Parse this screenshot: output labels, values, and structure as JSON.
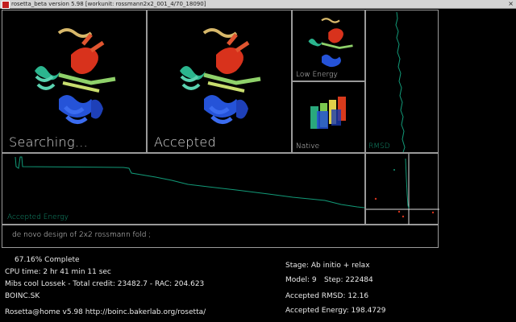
{
  "window": {
    "title": "rosetta_beta version 5.98 [workunit: rossmann2x2_001_4/70_18090]",
    "close_glyph": "×"
  },
  "panels": {
    "searching_label": "Searching...",
    "accepted_label": "Accepted",
    "low_energy_label": "Low Energy",
    "native_label": "Native",
    "rmsd_label": "RMSD",
    "accepted_energy_label": "Accepted Energy"
  },
  "description": "de novo design of 2x2 rossmann fold ;",
  "stats": {
    "complete": "67.16% Complete",
    "cpu_time": "CPU time: 2 hr 41 min 11 sec",
    "user_line": "Mibs cool Lossek - Total credit: 23482.7 - RAC: 204.623",
    "team": "BOINC.SK",
    "version_line": "Rosetta@home v5.98 http://boinc.bakerlab.org/rosetta/"
  },
  "progress": {
    "stage": "Stage: Ab initio + relax",
    "model": "Model: 9",
    "step": "Step: 222484",
    "accepted_rmsd": "Accepted RMSD: 12.16",
    "accepted_energy": "Accepted Energy: 198.4729"
  },
  "colors": {
    "panel_border": "#9a9a9a",
    "energy_trace": "#129a78",
    "marker_red": "#d4331c",
    "titlebar": "#d4d4d4"
  }
}
